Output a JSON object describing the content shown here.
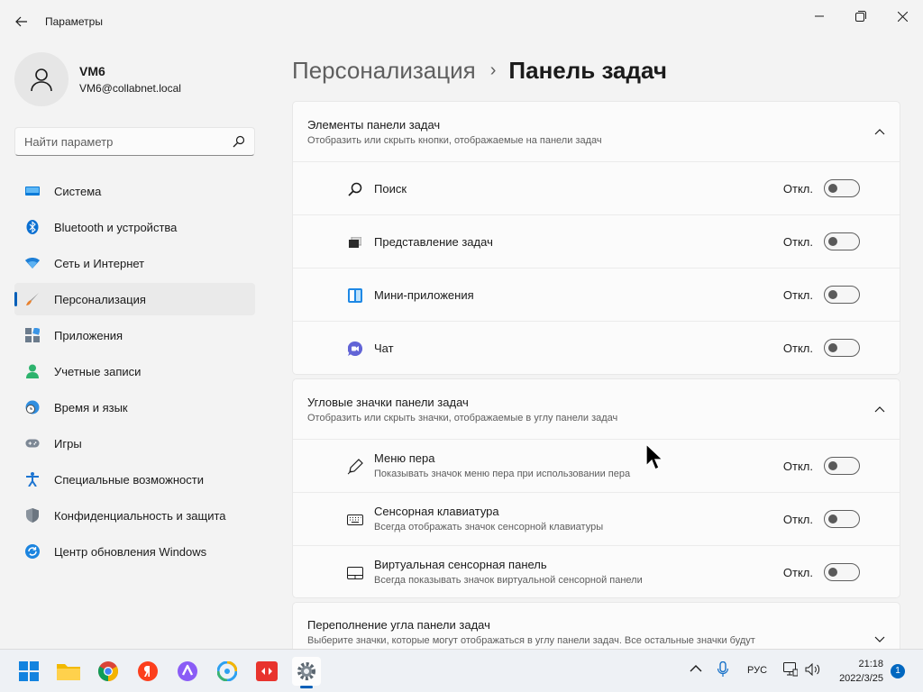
{
  "window": {
    "title": "Параметры"
  },
  "user": {
    "name": "VM6",
    "email": "VM6@collabnet.local"
  },
  "search": {
    "placeholder": "Найти параметр"
  },
  "sidebar": {
    "items": [
      {
        "label": "Система",
        "icon": "system-icon"
      },
      {
        "label": "Bluetooth и устройства",
        "icon": "bluetooth-icon"
      },
      {
        "label": "Сеть и Интернет",
        "icon": "network-icon"
      },
      {
        "label": "Персонализация",
        "icon": "brush-icon",
        "selected": true
      },
      {
        "label": "Приложения",
        "icon": "apps-icon"
      },
      {
        "label": "Учетные записи",
        "icon": "account-icon"
      },
      {
        "label": "Время и язык",
        "icon": "clock-globe-icon"
      },
      {
        "label": "Игры",
        "icon": "gamepad-icon"
      },
      {
        "label": "Специальные возможности",
        "icon": "accessibility-icon"
      },
      {
        "label": "Конфиденциальность и защита",
        "icon": "shield-icon"
      },
      {
        "label": "Центр обновления Windows",
        "icon": "update-icon"
      }
    ]
  },
  "breadcrumb": {
    "parent": "Персонализация",
    "separator": "›",
    "current": "Панель задач"
  },
  "taskbar_items": {
    "title": "Элементы панели задач",
    "subtitle": "Отобразить или скрыть кнопки, отображаемые на панели задач",
    "rows": [
      {
        "label": "Поиск",
        "state": "Откл.",
        "icon": "search-icon"
      },
      {
        "label": "Представление задач",
        "state": "Откл.",
        "icon": "task-view-icon"
      },
      {
        "label": "Мини-приложения",
        "state": "Откл.",
        "icon": "widgets-icon"
      },
      {
        "label": "Чат",
        "state": "Откл.",
        "icon": "chat-icon"
      }
    ]
  },
  "corner_icons": {
    "title": "Угловые значки панели задач",
    "subtitle": "Отобразить или скрыть значки, отображаемые в углу панели задач",
    "rows": [
      {
        "label": "Меню пера",
        "desc": "Показывать значок меню пера при использовании пера",
        "state": "Откл.",
        "icon": "pen-icon"
      },
      {
        "label": "Сенсорная клавиатура",
        "desc": "Всегда отображать значок сенсорной клавиатуры",
        "state": "Откл.",
        "icon": "keyboard-icon"
      },
      {
        "label": "Виртуальная сенсорная панель",
        "desc": "Всегда показывать значок виртуальной сенсорной панели",
        "state": "Откл.",
        "icon": "touchpad-icon"
      }
    ]
  },
  "overflow": {
    "title": "Переполнение угла панели задач",
    "subtitle": "Выберите значки, которые могут отображаться в углу панели задач. Все остальные значки будут"
  },
  "tray": {
    "lang": "РУС",
    "time": "21:18",
    "date": "2022/3/25",
    "notifications": "1"
  },
  "colors": {
    "accent": "#005fb8",
    "background": "#f3f3f3",
    "card": "#fbfbfb"
  }
}
